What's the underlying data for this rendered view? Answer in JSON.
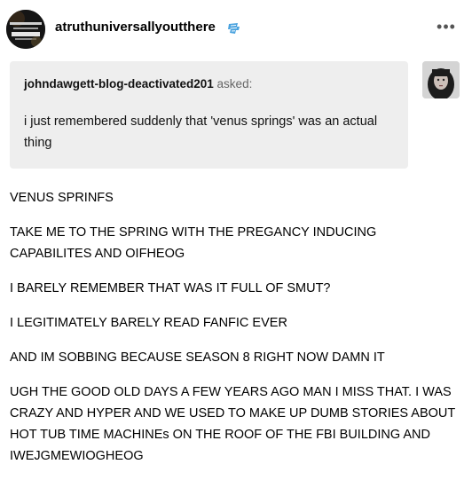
{
  "header": {
    "blog_name": "atruthuniversallyoutthere",
    "avatar_icon": "blog-avatar-icon",
    "badge_icon": "badge-icon",
    "more_label": "•••"
  },
  "ask": {
    "asker": "johndawgett-blog-deactivated201",
    "asked_label": "asked:",
    "question": "i just remembered suddenly that 'venus springs' was an actual thing"
  },
  "answer": [
    "VENUS SPRINFS",
    "TAKE ME TO THE SPRING WITH THE PREGANCY INDUCING CAPABILITES AND OIFHEOG",
    "I BARELY REMEMBER THAT WAS IT FULL OF SMUT?",
    "I LEGITIMATELY BARELY READ FANFIC EVER",
    "AND IM SOBBING BECAUSE SEASON 8 RIGHT NOW DAMN IT",
    "UGH THE GOOD OLD DAYS A FEW YEARS AGO MAN I MISS THAT. I WAS CRAZY AND HYPER AND WE USED TO MAKE UP DUMB STORIES ABOUT HOT TUB TIME MACHINEs ON THE ROOF OF THE FBI BUILDING AND IWEJGMEWIOGHEOG"
  ],
  "colors": {
    "ask_background": "#eeeeee",
    "badge_blue": "#4aa3df"
  }
}
